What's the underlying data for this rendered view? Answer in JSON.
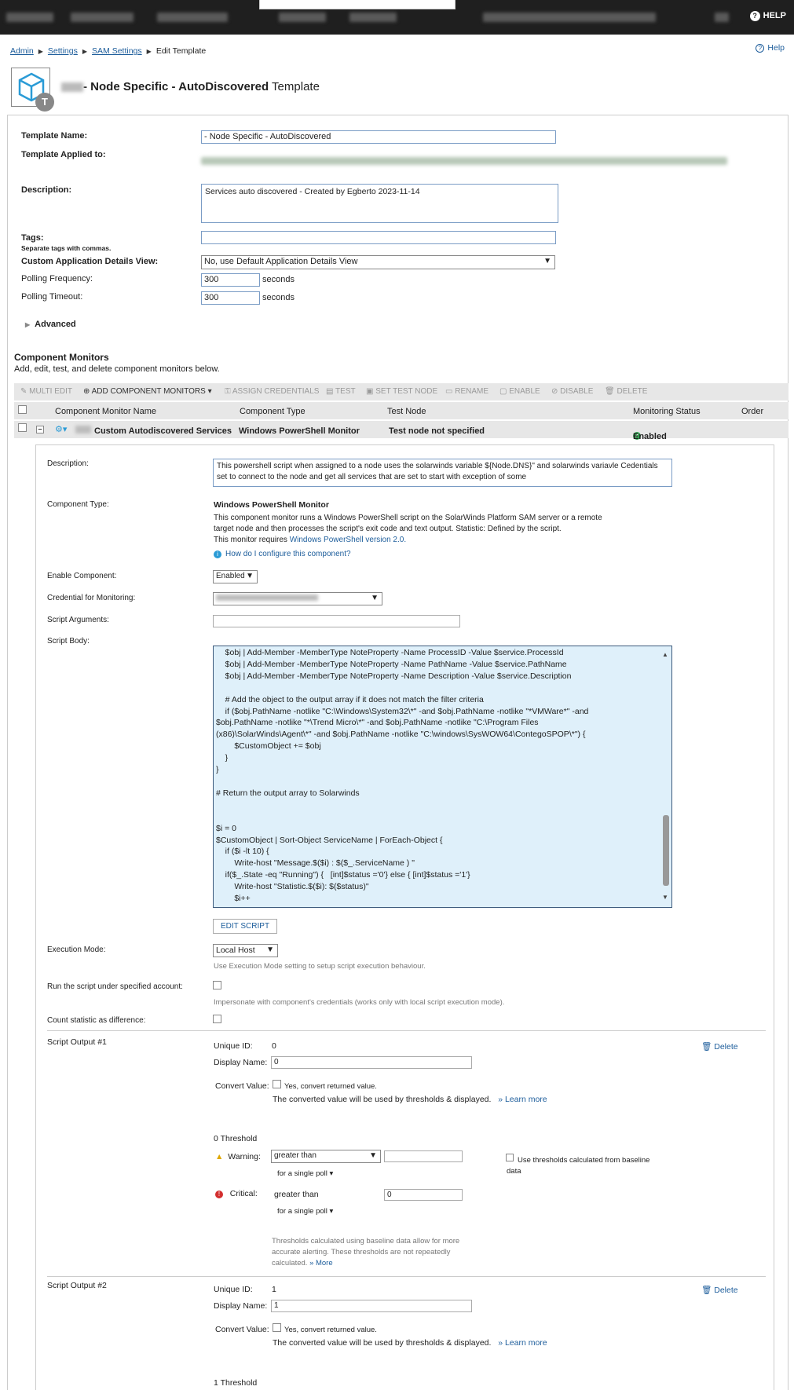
{
  "topbar": {
    "help_label": "HELP"
  },
  "breadcrumb": {
    "items": [
      "Admin",
      "Settings",
      "SAM Settings"
    ],
    "current": "Edit Template"
  },
  "help_link": "Help",
  "header": {
    "title_bold": "- Node Specific - AutoDiscovered",
    "title_suffix": " Template"
  },
  "form": {
    "template_name_label": "Template Name:",
    "template_name_value": " - Node Specific -  AutoDiscovered",
    "template_applied_label": "Template Applied to:",
    "description_label": "Description:",
    "description_value": "Services auto discovered - Created by Egberto 2023-11-14",
    "tags_label": "Tags:",
    "tags_hint": "Separate tags with commas.",
    "tags_value": "",
    "custom_view_label": "Custom Application Details View:",
    "custom_view_value": "No, use Default Application Details View",
    "polling_freq_label": "Polling Frequency:",
    "polling_freq_value": "300",
    "polling_timeout_label": "Polling Timeout:",
    "polling_timeout_value": "300",
    "seconds": "seconds",
    "advanced_label": "Advanced"
  },
  "component_monitors": {
    "title": "Component Monitors",
    "subtitle": "Add, edit, test, and delete component monitors below.",
    "toolbar": {
      "multi_edit": "MULTI EDIT",
      "add": "ADD COMPONENT MONITORS",
      "assign": "ASSIGN CREDENTIALS",
      "test": "TEST",
      "set_test_node": "SET TEST NODE",
      "rename": "RENAME",
      "enable": "ENABLE",
      "disable": "DISABLE",
      "delete": "DELETE"
    },
    "columns": [
      "Component Monitor Name",
      "Component Type",
      "Test Node",
      "Monitoring Status",
      "Order"
    ],
    "row": {
      "name": "Custom Autodiscovered Services",
      "type": "Windows PowerShell Monitor",
      "test_node": "Test node not specified",
      "status": "Enabled"
    }
  },
  "detail": {
    "description_label": "Description:",
    "description_value": "This powershell script  when assigned to a node uses the solarwinds variable ${Node.DNS}\" and solarwinds variavle Cedentials set to   connect to the node and get all services that are set to start with exception of  some",
    "component_type_label": "Component Type:",
    "component_type_value": "Windows PowerShell Monitor",
    "component_type_desc1": "This component monitor runs a Windows PowerShell script on the SolarWinds Platform SAM server or a remote",
    "component_type_desc2": "target node and then processes the script's exit code and text output. Statistic: Defined by the script.",
    "component_type_desc3": "This monitor requires ",
    "component_type_link": "Windows PowerShell version 2.0.",
    "configure_link": "How do I configure this component?",
    "enable_label": "Enable Component:",
    "enable_value": "Enabled",
    "credential_label": "Credential for Monitoring:",
    "script_args_label": "Script Arguments:",
    "script_args_value": "",
    "script_body_label": "Script Body:",
    "script_lines": [
      "    $obj | Add-Member -MemberType NoteProperty -Name ProcessID -Value $service.ProcessId",
      "    $obj | Add-Member -MemberType NoteProperty -Name PathName -Value $service.PathName",
      "    $obj | Add-Member -MemberType NoteProperty -Name Description -Value $service.Description",
      "",
      "    # Add the object to the output array if it does not match the filter criteria",
      "    if ($obj.PathName -notlike \"C:\\Windows\\System32\\*\" -and $obj.PathName -notlike \"*VMWare*\" -and",
      "$obj.PathName -notlike \"*\\Trend Micro\\*\" -and $obj.PathName -notlike \"C:\\Program Files",
      "(x86)\\SolarWinds\\Agent\\*\" -and $obj.PathName -notlike \"C:\\windows\\SysWOW64\\ContegoSPOP\\*\") {",
      "        $CustomObject += $obj",
      "    }",
      "}",
      "",
      "# Return the output array to Solarwinds",
      "",
      "",
      "$i = 0",
      "$CustomObject | Sort-Object ServiceName | ForEach-Object {",
      "    if ($i -lt 10) {",
      "        Write-host \"Message.$($i) : $($_.ServiceName ) \"",
      "    if($_.State -eq \"Running\") {   [int]$status ='0'} else { [int]$status ='1'}",
      "        Write-host \"Statistic.$($i): $($status)\"",
      "        $i++"
    ],
    "edit_script": "EDIT SCRIPT",
    "execution_label": "Execution Mode:",
    "execution_value": "Local Host",
    "execution_hint": "Use Execution Mode setting to setup script execution behaviour.",
    "run_as_label": "Run the script under specified account:",
    "run_as_hint": "Impersonate with component's credentials (works only with local script execution mode).",
    "count_diff_label": "Count statistic as difference:"
  },
  "outputs": [
    {
      "title": "Script Output #1",
      "unique_id_label": "Unique ID:",
      "unique_id": "0",
      "display_name_label": "Display Name:",
      "display_name": "0",
      "convert_label": "Convert Value:",
      "convert_check": "Yes, convert returned value.",
      "convert_note": "The converted value will be used by thresholds & displayed.",
      "learn_more": "» Learn more",
      "delete": "Delete",
      "threshold_title": "0 Threshold",
      "warning_label": "Warning:",
      "warning_op": "greater than",
      "warning_value": "",
      "warning_poll": "for a single poll",
      "critical_label": "Critical:",
      "critical_op": "greater than",
      "critical_value": "0",
      "critical_poll": "for a single poll",
      "baseline_label": "Use thresholds calculated from baseline data",
      "baseline_note1": "Thresholds calculated using baseline data allow for more",
      "baseline_note2": "accurate alerting. These thresholds are not repeatedly",
      "baseline_note3": "calculated.",
      "more_link": "» More"
    },
    {
      "title": "Script Output #2",
      "unique_id_label": "Unique ID:",
      "unique_id": "1",
      "display_name_label": "Display Name:",
      "display_name": "1",
      "convert_label": "Convert Value:",
      "convert_check": "Yes, convert returned value.",
      "convert_note": "The converted value will be used by thresholds & displayed.",
      "learn_more": "» Learn more",
      "delete": "Delete",
      "threshold_title": "1 Threshold"
    }
  ]
}
